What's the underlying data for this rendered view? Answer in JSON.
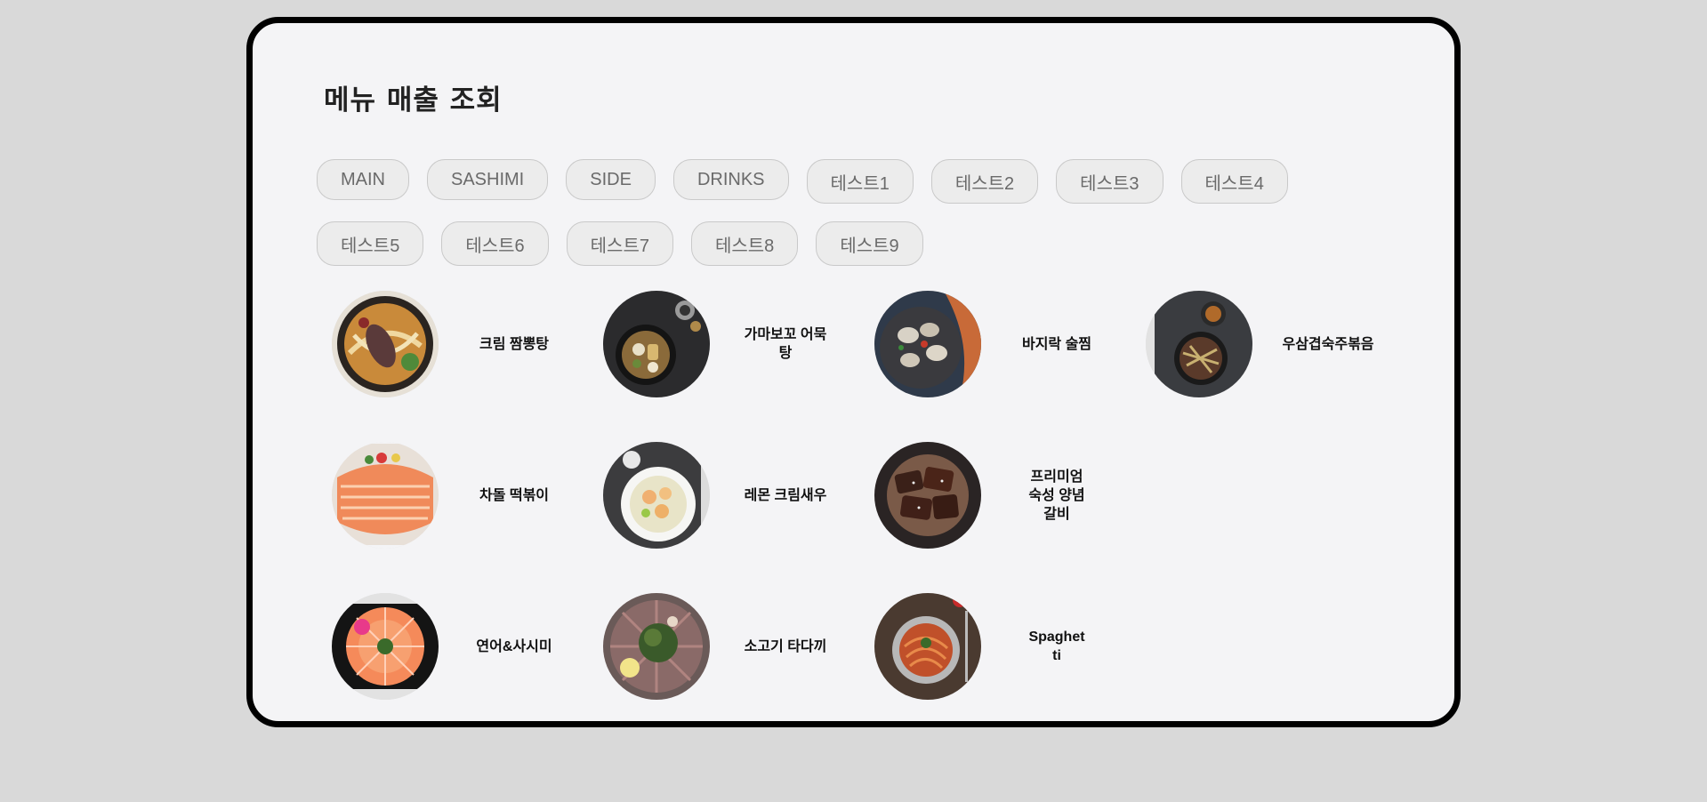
{
  "page": {
    "title": "메뉴 매출 조회"
  },
  "categories": [
    {
      "label": "MAIN"
    },
    {
      "label": "SASHIMI"
    },
    {
      "label": "SIDE"
    },
    {
      "label": "DRINKS"
    },
    {
      "label": "테스트1"
    },
    {
      "label": "테스트2"
    },
    {
      "label": "테스트3"
    },
    {
      "label": "테스트4"
    },
    {
      "label": "테스트5"
    },
    {
      "label": "테스트6"
    },
    {
      "label": "테스트7"
    },
    {
      "label": "테스트8"
    },
    {
      "label": "테스트9"
    }
  ],
  "menu_items": [
    {
      "name": "크림 짬뽕탕",
      "photo": "cream-jjamppong-photo"
    },
    {
      "name": "가마보꼬 어묵탕",
      "photo": "fishcake-soup-photo"
    },
    {
      "name": "바지락 술찜",
      "photo": "clam-steam-photo"
    },
    {
      "name": "우삼겹숙주볶음",
      "photo": "beef-sprout-stirfry-photo"
    },
    {
      "name": "차돌 떡볶이",
      "photo": "salmon-platter-photo"
    },
    {
      "name": "레몬 크림새우",
      "photo": "lemon-cream-shrimp-photo"
    },
    {
      "name": "프리미엄 숙성 양념갈비",
      "photo": "marinated-ribs-photo"
    },
    {
      "name": "연어&사시미",
      "photo": "salmon-sashimi-photo"
    },
    {
      "name": "소고기 타다끼",
      "photo": "beef-tataki-photo"
    },
    {
      "name": "Spaghetti",
      "photo": "spaghetti-photo"
    }
  ]
}
